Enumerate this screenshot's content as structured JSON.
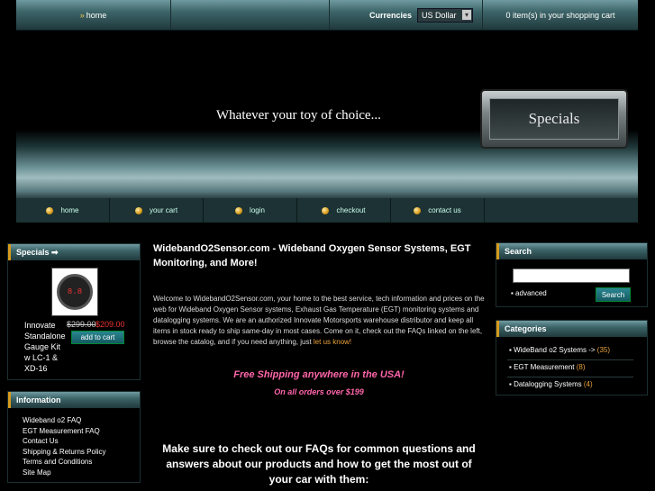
{
  "topbar": {
    "home_arrow": "»",
    "home_label": "home",
    "currencies_label": "Currencies",
    "currency_value": "US Dollar",
    "cart_summary": "0 item(s) in your shopping cart"
  },
  "banner": {
    "tagline": "Whatever your toy of choice...",
    "specials_badge": "Specials"
  },
  "nav": {
    "items": [
      {
        "label": "home"
      },
      {
        "label": "your cart"
      },
      {
        "label": "login"
      },
      {
        "label": "checkout"
      },
      {
        "label": "contact us"
      }
    ]
  },
  "specials": {
    "heading": "Specials ➡",
    "product_name": "Innovate Standalone Gauge Kit w LC-1 & XD-16",
    "old_price": "$299.00",
    "new_price": "$209.00",
    "add_to_cart": "add to cart",
    "gauge_display": "8.8"
  },
  "information": {
    "heading": "Information",
    "links": [
      "Wideband o2 FAQ",
      "EGT Measurement FAQ",
      "Contact Us",
      "Shipping & Returns Policy",
      "Terms and Conditions",
      "Site Map"
    ]
  },
  "main": {
    "title": "WidebandO2Sensor.com - Wideband Oxygen Sensor Systems, EGT Monitoring, and More!",
    "welcome_text": "Welcome to WidebandO2Sensor.com, your home to the best service, tech information and prices on the web for Wideband Oxygen Sensor systems, Exhaust Gas Temperature (EGT) monitoring systems and datalogging systems.  We are an authorized Innovate Motorsports warehouse distributor and keep all items in stock ready to ship same-day in most cases.  Come on it, check out the FAQs linked on the left, browse the catalog, and if you need anything, just ",
    "contact_link": "let us know!",
    "free_shipping": "Free Shipping anywhere in the USA!",
    "orders_over": "On all orders over $199",
    "faq_note": "Make sure to check out our FAQs for common questions and answers about our products and how to get the most out of your car with them:"
  },
  "search": {
    "heading": "Search",
    "advanced": "▪ advanced",
    "button": "Search"
  },
  "categories": {
    "heading": "Categories",
    "items": [
      {
        "label": "WideBand o2 Systems ->",
        "count": "(35)"
      },
      {
        "label": "EGT Measurement",
        "count": "(8)"
      },
      {
        "label": "Datalogging Systems",
        "count": "(4)"
      }
    ]
  },
  "colors": {
    "accent": "#d79a1c",
    "teal": "#3c6468",
    "sale_price": "#e33333",
    "promo_pink": "#ff66aa"
  }
}
